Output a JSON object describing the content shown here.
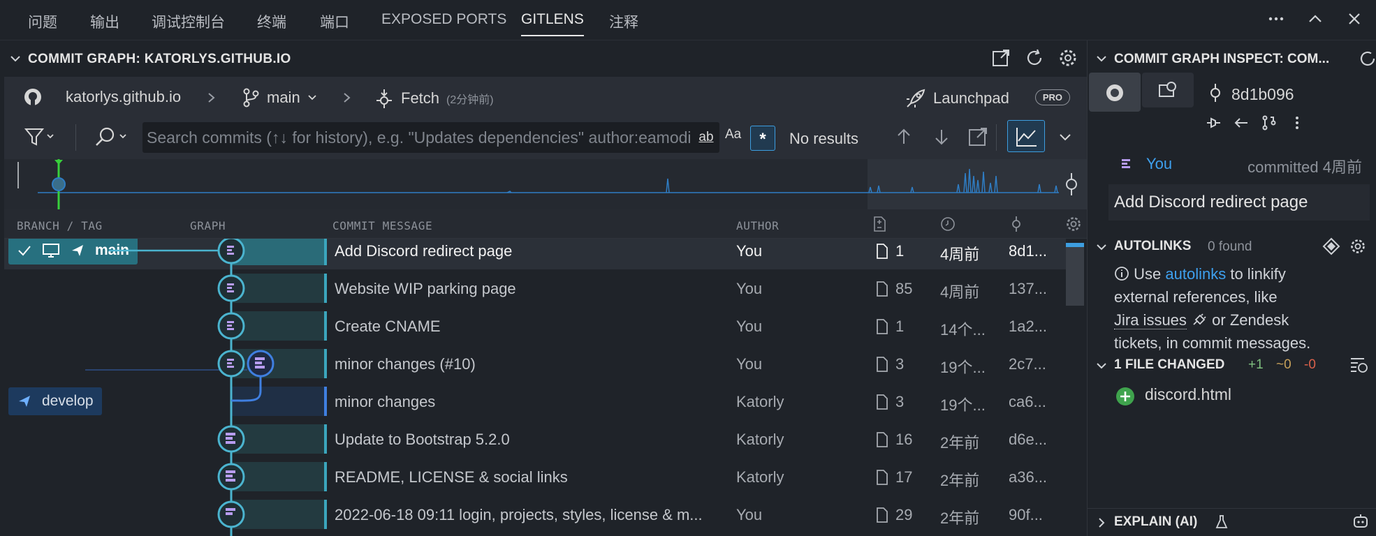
{
  "tabs": [
    {
      "label": "问题",
      "active": false
    },
    {
      "label": "输出",
      "active": false
    },
    {
      "label": "调试控制台",
      "active": false
    },
    {
      "label": "终端",
      "active": false
    },
    {
      "label": "端口",
      "active": false
    },
    {
      "label": "EXPOSED PORTS",
      "active": false
    },
    {
      "label": "GITLENS",
      "active": true
    },
    {
      "label": "注释",
      "active": false
    }
  ],
  "graph": {
    "title": "COMMIT GRAPH: KATORLYS.GITHUB.IO",
    "repo": "katorlys.github.io",
    "branch": "main",
    "fetch_label": "Fetch",
    "fetch_time": "(2分钟前)",
    "launchpad": "Launchpad",
    "pro_badge": "PRO",
    "search_placeholder": "Search commits (↑↓ for history), e.g. \"Updates dependencies\" author:eamodio",
    "search_opt_ab": "ab",
    "search_opt_case": "Aa",
    "search_opt_regex": "*",
    "no_results": "No results",
    "columns": {
      "branch": "BRANCH / TAG",
      "graph": "GRAPH",
      "message": "COMMIT MESSAGE",
      "author": "AUTHOR"
    },
    "branches": {
      "main": "main",
      "develop": "develop"
    },
    "commits": [
      {
        "message": "Add Discord redirect page",
        "author": "You",
        "files": "1",
        "date": "4周前",
        "sha": "8d1..."
      },
      {
        "message": "Website WIP parking page",
        "author": "You",
        "files": "85",
        "date": "4周前",
        "sha": "137..."
      },
      {
        "message": "Create CNAME",
        "author": "You",
        "files": "1",
        "date": "14个...",
        "sha": "1a2..."
      },
      {
        "message": "minor changes (#10)",
        "author": "You",
        "files": "3",
        "date": "19个...",
        "sha": "2c7..."
      },
      {
        "message": "minor changes",
        "author": "Katorly",
        "files": "3",
        "date": "19个...",
        "sha": "ca6..."
      },
      {
        "message": "Update to Bootstrap 5.2.0",
        "author": "Katorly",
        "files": "16",
        "date": "2年前",
        "sha": "d6e..."
      },
      {
        "message": "README, LICENSE & social links",
        "author": "Katorly",
        "files": "17",
        "date": "2年前",
        "sha": "a36..."
      },
      {
        "message": "2022-06-18 09:11 login, projects, styles, license & m...",
        "author": "You",
        "files": "29",
        "date": "2年前",
        "sha": "90f..."
      }
    ]
  },
  "inspect": {
    "title": "COMMIT GRAPH INSPECT: COM...",
    "sha": "8d1b096",
    "author": "You",
    "committed": "committed 4周前",
    "message": "Add Discord redirect page",
    "autolinks_title": "AUTOLINKS",
    "autolinks_found": "0 found",
    "autolinks_text_1": "Use",
    "autolinks_link": "autolinks",
    "autolinks_text_2": "to linkify",
    "autolinks_text_3": "external references, like",
    "autolinks_jira": "Jira issues",
    "autolinks_text_4": "or Zendesk",
    "autolinks_text_5": "tickets, in commit messages.",
    "files_title": "1 FILE CHANGED",
    "added": "+1",
    "modified": "~0",
    "deleted": "-0",
    "file_name": "discord.html",
    "explain_title": "EXPLAIN (AI)"
  }
}
